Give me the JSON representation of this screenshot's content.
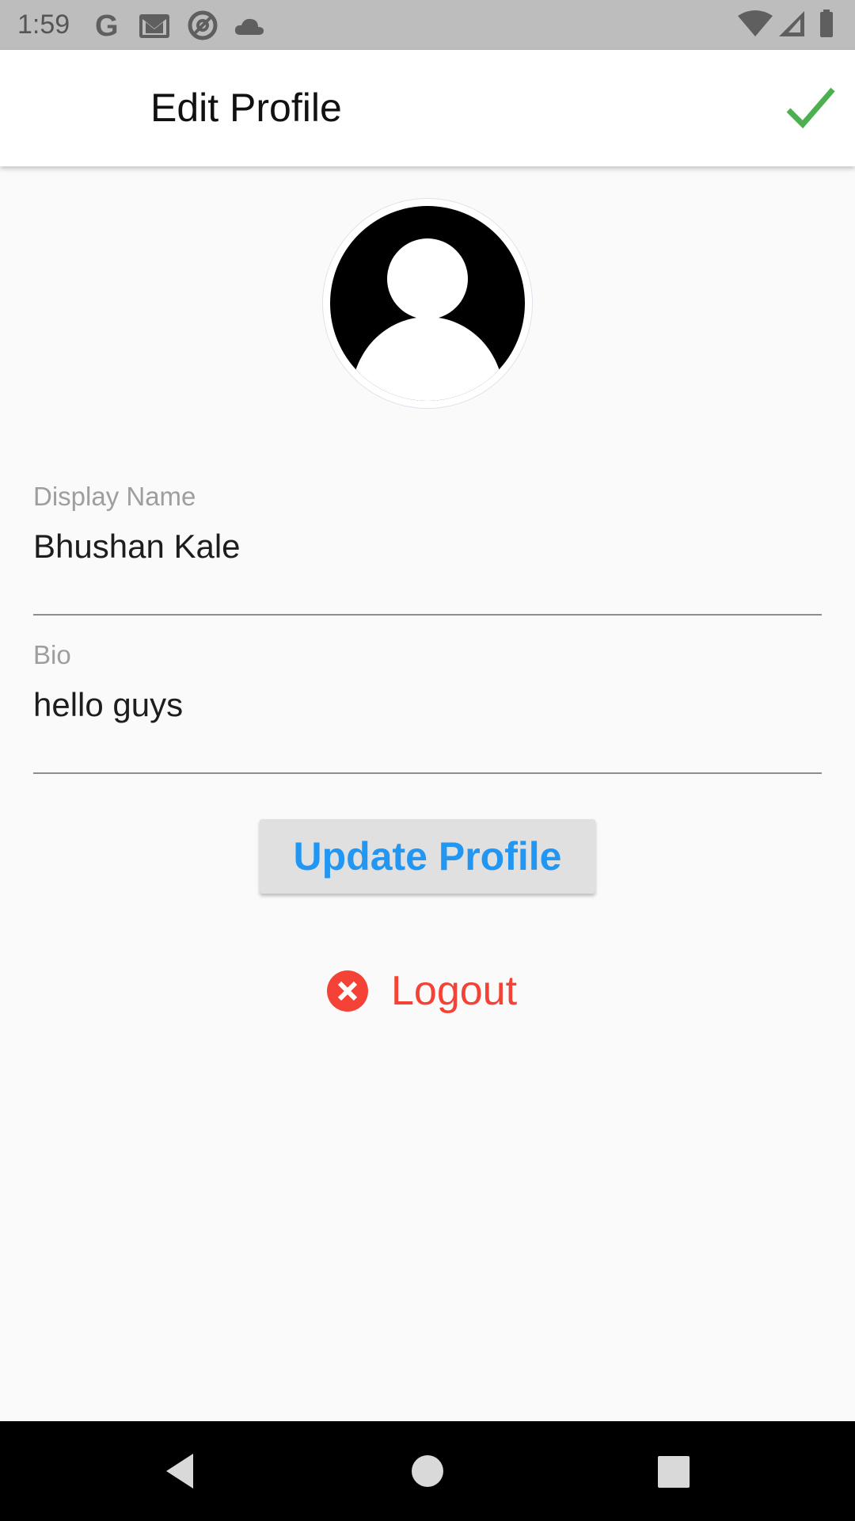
{
  "status_bar": {
    "time": "1:59",
    "left_icons": [
      "google-icon",
      "gmail-icon",
      "at-sign-icon",
      "cloud-icon"
    ],
    "right_icons": [
      "wifi-icon",
      "signal-icon",
      "battery-icon"
    ]
  },
  "app_bar": {
    "title": "Edit Profile",
    "action_icon": "check-icon",
    "action_color": "#4caf50"
  },
  "profile": {
    "avatar_icon": "person-avatar-icon"
  },
  "form": {
    "display_name": {
      "label": "Display Name",
      "value": "Bhushan Kale"
    },
    "bio": {
      "label": "Bio",
      "value": "hello guys"
    }
  },
  "actions": {
    "update_label": "Update Profile",
    "update_color": "#2196f3",
    "logout_label": "Logout",
    "logout_icon": "cancel-circle-icon",
    "logout_color": "#f44336"
  },
  "nav_bar": {
    "buttons": [
      "back-icon",
      "home-icon",
      "recents-icon"
    ]
  }
}
